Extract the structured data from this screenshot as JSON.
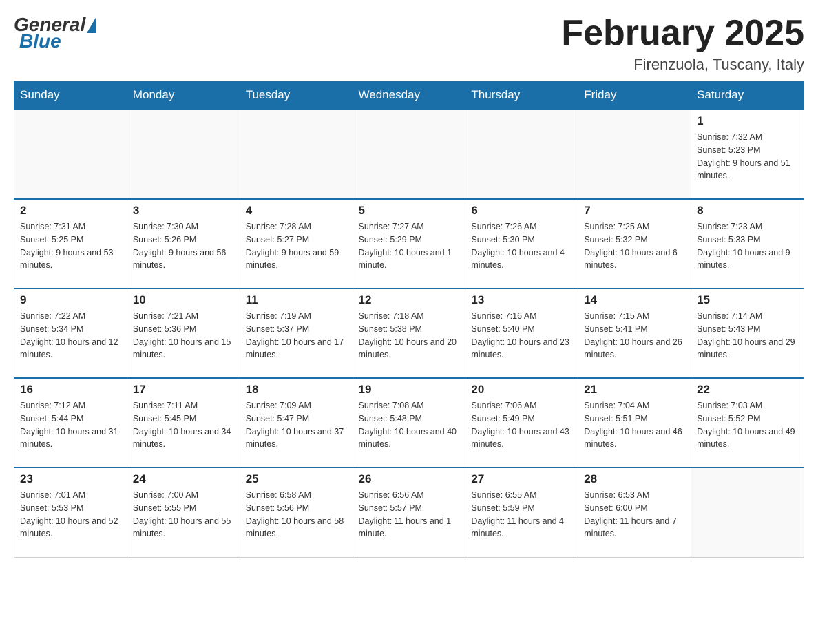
{
  "header": {
    "logo": {
      "general_text": "General",
      "blue_text": "Blue"
    },
    "title": "February 2025",
    "location": "Firenzuola, Tuscany, Italy"
  },
  "weekdays": [
    "Sunday",
    "Monday",
    "Tuesday",
    "Wednesday",
    "Thursday",
    "Friday",
    "Saturday"
  ],
  "weeks": [
    [
      {
        "day": "",
        "info": ""
      },
      {
        "day": "",
        "info": ""
      },
      {
        "day": "",
        "info": ""
      },
      {
        "day": "",
        "info": ""
      },
      {
        "day": "",
        "info": ""
      },
      {
        "day": "",
        "info": ""
      },
      {
        "day": "1",
        "info": "Sunrise: 7:32 AM\nSunset: 5:23 PM\nDaylight: 9 hours and 51 minutes."
      }
    ],
    [
      {
        "day": "2",
        "info": "Sunrise: 7:31 AM\nSunset: 5:25 PM\nDaylight: 9 hours and 53 minutes."
      },
      {
        "day": "3",
        "info": "Sunrise: 7:30 AM\nSunset: 5:26 PM\nDaylight: 9 hours and 56 minutes."
      },
      {
        "day": "4",
        "info": "Sunrise: 7:28 AM\nSunset: 5:27 PM\nDaylight: 9 hours and 59 minutes."
      },
      {
        "day": "5",
        "info": "Sunrise: 7:27 AM\nSunset: 5:29 PM\nDaylight: 10 hours and 1 minute."
      },
      {
        "day": "6",
        "info": "Sunrise: 7:26 AM\nSunset: 5:30 PM\nDaylight: 10 hours and 4 minutes."
      },
      {
        "day": "7",
        "info": "Sunrise: 7:25 AM\nSunset: 5:32 PM\nDaylight: 10 hours and 6 minutes."
      },
      {
        "day": "8",
        "info": "Sunrise: 7:23 AM\nSunset: 5:33 PM\nDaylight: 10 hours and 9 minutes."
      }
    ],
    [
      {
        "day": "9",
        "info": "Sunrise: 7:22 AM\nSunset: 5:34 PM\nDaylight: 10 hours and 12 minutes."
      },
      {
        "day": "10",
        "info": "Sunrise: 7:21 AM\nSunset: 5:36 PM\nDaylight: 10 hours and 15 minutes."
      },
      {
        "day": "11",
        "info": "Sunrise: 7:19 AM\nSunset: 5:37 PM\nDaylight: 10 hours and 17 minutes."
      },
      {
        "day": "12",
        "info": "Sunrise: 7:18 AM\nSunset: 5:38 PM\nDaylight: 10 hours and 20 minutes."
      },
      {
        "day": "13",
        "info": "Sunrise: 7:16 AM\nSunset: 5:40 PM\nDaylight: 10 hours and 23 minutes."
      },
      {
        "day": "14",
        "info": "Sunrise: 7:15 AM\nSunset: 5:41 PM\nDaylight: 10 hours and 26 minutes."
      },
      {
        "day": "15",
        "info": "Sunrise: 7:14 AM\nSunset: 5:43 PM\nDaylight: 10 hours and 29 minutes."
      }
    ],
    [
      {
        "day": "16",
        "info": "Sunrise: 7:12 AM\nSunset: 5:44 PM\nDaylight: 10 hours and 31 minutes."
      },
      {
        "day": "17",
        "info": "Sunrise: 7:11 AM\nSunset: 5:45 PM\nDaylight: 10 hours and 34 minutes."
      },
      {
        "day": "18",
        "info": "Sunrise: 7:09 AM\nSunset: 5:47 PM\nDaylight: 10 hours and 37 minutes."
      },
      {
        "day": "19",
        "info": "Sunrise: 7:08 AM\nSunset: 5:48 PM\nDaylight: 10 hours and 40 minutes."
      },
      {
        "day": "20",
        "info": "Sunrise: 7:06 AM\nSunset: 5:49 PM\nDaylight: 10 hours and 43 minutes."
      },
      {
        "day": "21",
        "info": "Sunrise: 7:04 AM\nSunset: 5:51 PM\nDaylight: 10 hours and 46 minutes."
      },
      {
        "day": "22",
        "info": "Sunrise: 7:03 AM\nSunset: 5:52 PM\nDaylight: 10 hours and 49 minutes."
      }
    ],
    [
      {
        "day": "23",
        "info": "Sunrise: 7:01 AM\nSunset: 5:53 PM\nDaylight: 10 hours and 52 minutes."
      },
      {
        "day": "24",
        "info": "Sunrise: 7:00 AM\nSunset: 5:55 PM\nDaylight: 10 hours and 55 minutes."
      },
      {
        "day": "25",
        "info": "Sunrise: 6:58 AM\nSunset: 5:56 PM\nDaylight: 10 hours and 58 minutes."
      },
      {
        "day": "26",
        "info": "Sunrise: 6:56 AM\nSunset: 5:57 PM\nDaylight: 11 hours and 1 minute."
      },
      {
        "day": "27",
        "info": "Sunrise: 6:55 AM\nSunset: 5:59 PM\nDaylight: 11 hours and 4 minutes."
      },
      {
        "day": "28",
        "info": "Sunrise: 6:53 AM\nSunset: 6:00 PM\nDaylight: 11 hours and 7 minutes."
      },
      {
        "day": "",
        "info": ""
      }
    ]
  ]
}
